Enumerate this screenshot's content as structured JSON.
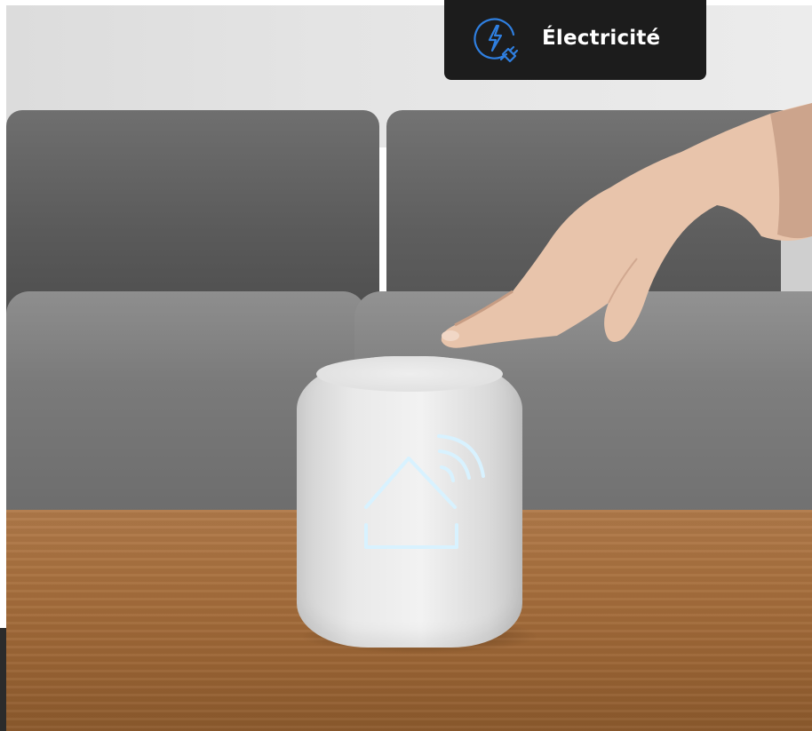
{
  "category_badge": {
    "label": "Électricité",
    "icon": "lightning-plug-icon",
    "icon_color": "#2f7fe0",
    "background_color": "#1c1c1c"
  },
  "photo": {
    "speaker_icon": "smart-home-wifi-icon",
    "speaker_icon_color": "#d8f2ff"
  }
}
